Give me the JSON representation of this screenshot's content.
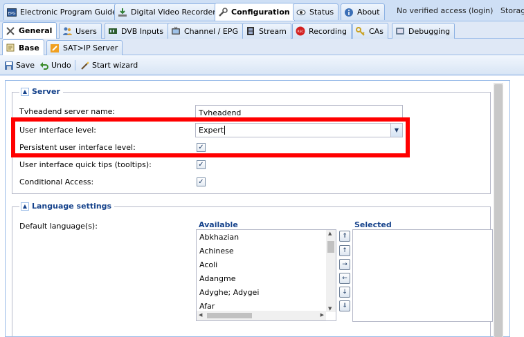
{
  "top_tabs": [
    {
      "label": "Electronic Program Guide",
      "icon": "epg-icon"
    },
    {
      "label": "Digital Video Recorder",
      "icon": "download-icon"
    },
    {
      "label": "Configuration",
      "icon": "wrench-icon",
      "active": true
    },
    {
      "label": "Status",
      "icon": "eye-icon"
    },
    {
      "label": "About",
      "icon": "info-icon"
    }
  ],
  "top_status": {
    "verified": "No verified access",
    "login": "(login)",
    "storage": "Storag"
  },
  "config_tabs": [
    {
      "label": "General",
      "icon": "tools-icon",
      "active": true
    },
    {
      "label": "Users",
      "icon": "users-icon"
    },
    {
      "label": "DVB Inputs",
      "icon": "dvb-icon"
    },
    {
      "label": "Channel / EPG",
      "icon": "tv-icon"
    },
    {
      "label": "Stream",
      "icon": "film-icon"
    },
    {
      "label": "Recording",
      "icon": "rec-icon"
    },
    {
      "label": "CAs",
      "icon": "key-icon"
    },
    {
      "label": "Debugging",
      "icon": "bug-icon"
    }
  ],
  "sub_tabs": [
    {
      "label": "Base",
      "icon": "base-icon",
      "active": true
    },
    {
      "label": "SAT>IP Server",
      "icon": "satip-icon"
    }
  ],
  "toolbar": {
    "save": "Save",
    "undo": "Undo",
    "wizard": "Start wizard"
  },
  "server": {
    "legend": "Server",
    "name_label": "Tvheadend server name:",
    "name_value": "Tvheadend",
    "ui_level_label": "User interface level:",
    "ui_level_value": "Expert",
    "persistent_label": "Persistent user interface level:",
    "persistent_checked": true,
    "tooltips_label": "User interface quick tips (tooltips):",
    "tooltips_checked": true,
    "ca_label": "Conditional Access:",
    "ca_checked": true
  },
  "language": {
    "legend": "Language settings",
    "default_label": "Default language(s):",
    "available_header": "Available",
    "selected_header": "Selected",
    "available": [
      "Abkhazian",
      "Achinese",
      "Acoli",
      "Adangme",
      "Adyghe; Adygei",
      "Afar"
    ]
  },
  "colors": {
    "highlight": "#ff0000",
    "accent": "#15428b"
  }
}
